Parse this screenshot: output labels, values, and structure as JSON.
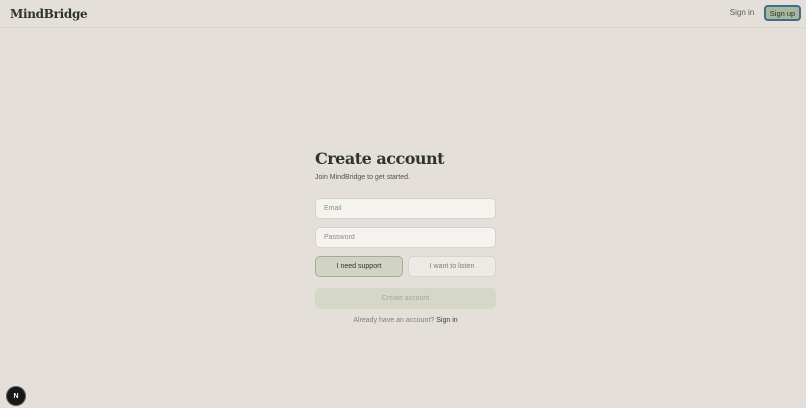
{
  "header": {
    "brand": "MindBridge",
    "signin_label": "Sign in",
    "signup_label": "Sign up"
  },
  "form": {
    "title": "Create account",
    "subtitle": "Join MindBridge to get started.",
    "email_placeholder": "Email",
    "password_placeholder": "Password",
    "role_support_label": "I need support",
    "role_listen_label": "I want to listen",
    "submit_label": "Create account",
    "footer_text": "Already have an account?",
    "footer_link": "Sign in"
  },
  "badge": {
    "label": "N"
  },
  "colors": {
    "background": "#e4dfd9",
    "accent": "#a9b79c",
    "focus_ring": "#3f6d8f",
    "badge": "#171717"
  }
}
